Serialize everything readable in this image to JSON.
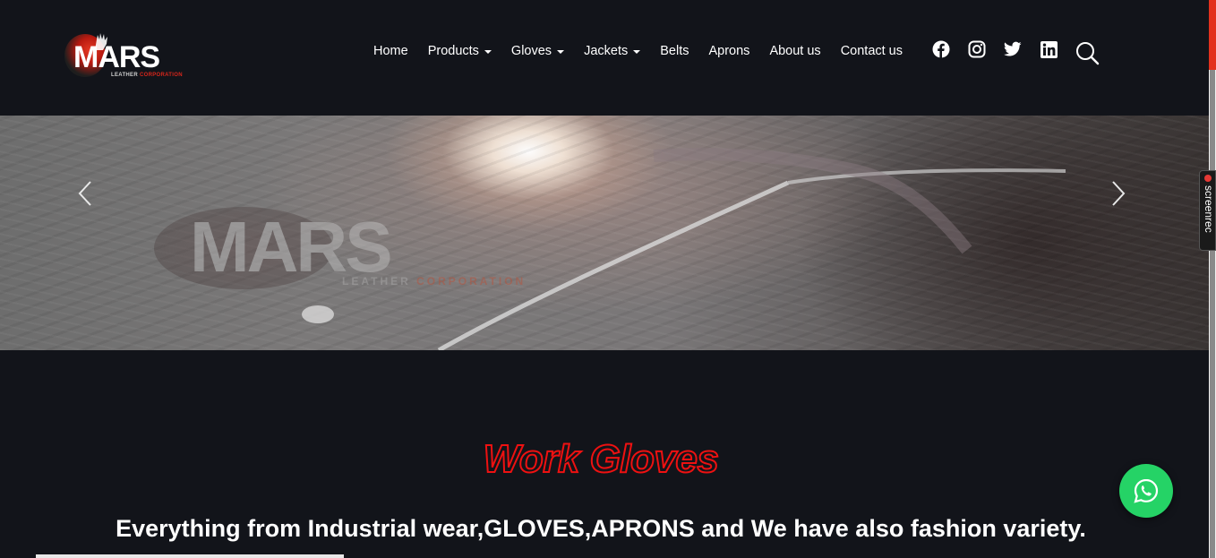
{
  "logo": {
    "word": "MARS",
    "sub_main": "LEATHER ",
    "sub_accent": "CORPORATION"
  },
  "nav": {
    "items": [
      {
        "label": "Home",
        "dropdown": false
      },
      {
        "label": "Products",
        "dropdown": true
      },
      {
        "label": "Gloves",
        "dropdown": true
      },
      {
        "label": "Jackets",
        "dropdown": true
      },
      {
        "label": "Belts",
        "dropdown": false
      },
      {
        "label": "Aprons",
        "dropdown": false
      },
      {
        "label": "About us",
        "dropdown": false
      },
      {
        "label": "Contact us",
        "dropdown": false
      }
    ]
  },
  "social": {
    "icons": [
      "facebook-icon",
      "instagram-icon",
      "twitter-icon",
      "linkedin-icon"
    ],
    "search_icon": "search-icon"
  },
  "hero": {
    "watermark_word": "MARS",
    "watermark_sub_main": "LEATHER ",
    "watermark_sub_accent": "CORPORATION",
    "prev_icon": "chevron-left-icon",
    "next_icon": "chevron-right-icon"
  },
  "content": {
    "headline": "Work Gloves",
    "tagline": "Everything from Industrial wear,GLOVES,APRONS and We have also fashion variety."
  },
  "widgets": {
    "whatsapp_icon": "whatsapp-icon",
    "screenrec_label": "screenrec"
  },
  "colors": {
    "background": "#12141a",
    "accent_red": "#e3311d",
    "headline_stroke": "#ee1111",
    "whatsapp_green": "#25d366"
  }
}
